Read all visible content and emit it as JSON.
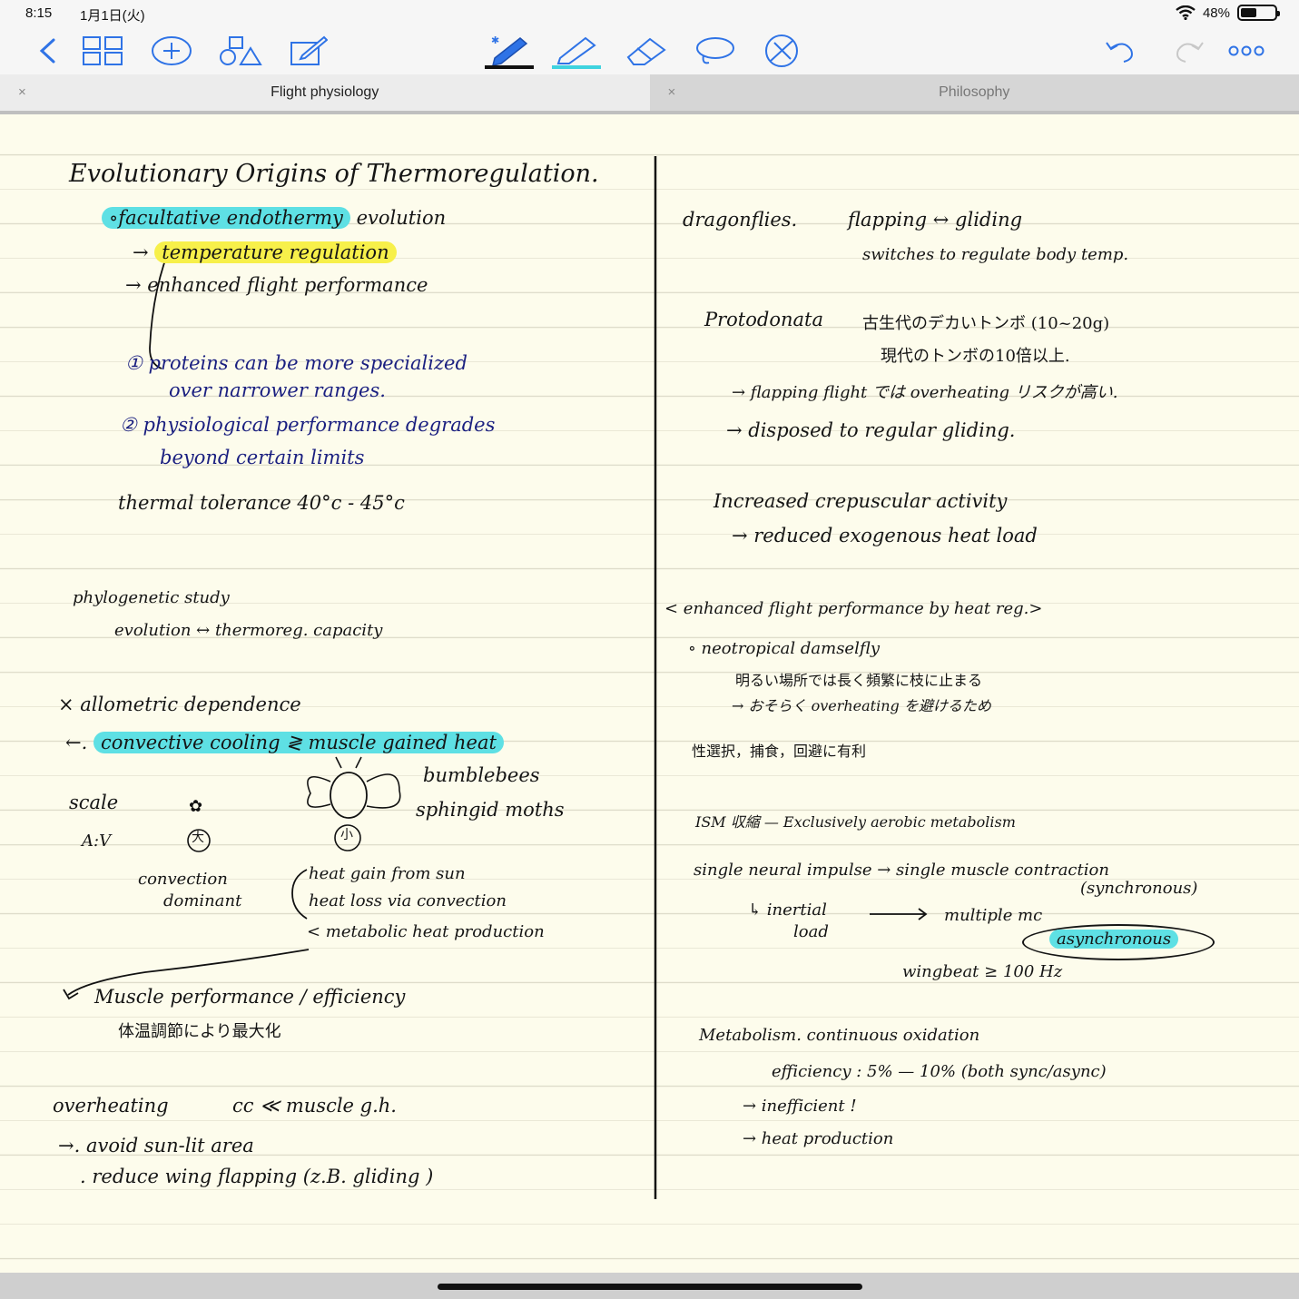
{
  "status": {
    "time": "8:15",
    "date": "1月1日(火)",
    "battery": "48%",
    "battery_level": 0.48
  },
  "toolbar": {
    "left": [
      "back-icon",
      "grid-icon",
      "add-icon",
      "shapes-icon",
      "edit-icon"
    ],
    "center": [
      "pen-icon",
      "highlighter-icon",
      "eraser-icon",
      "lasso-icon",
      "no-write-icon"
    ],
    "right": [
      "undo-icon",
      "redo-icon",
      "more-icon"
    ]
  },
  "tabs": [
    {
      "title": "Flight physiology",
      "close": "×"
    },
    {
      "title": "Philosophy",
      "close": "×"
    }
  ],
  "notes": {
    "left": {
      "title": "Evolutionary Origins of Thermoregulation.",
      "l1": "∘facultative endothermy",
      "l1b": "evolution",
      "l2_arrow": "→",
      "l2": "temperature regulation",
      "l3": "→ enhanced flight performance",
      "b1": "① proteins can be more specialized",
      "b1b": "over narrower ranges.",
      "b2": "② physiological performance degrades",
      "b2b": "beyond certain limits",
      "tol": "thermal tolerance   40°c - 45°c",
      "phy": "phylogenetic study",
      "evo": "evolution ↔ thermoreg. capacity",
      "allo": "× allometric dependence",
      "conv_arrow": "←.",
      "conv": "convective cooling ≷ muscle gained heat",
      "bees": "bumblebees",
      "moths": "sphingid moths",
      "scale": "scale",
      "av": "A:V",
      "av_big": "大",
      "av_small": "小",
      "cd1": "convection",
      "cd2": "dominant",
      "hg": "heat gain from sun",
      "hl": "heat loss via convection",
      "mhp": "< metabolic heat production",
      "mpe": "Muscle performance / efficiency",
      "jp1": "体温調節により最大化",
      "oh": "overheating",
      "oh2": "cc ≪ muscle g.h.",
      "avoid": "→. avoid sun-lit area",
      "reduce": ". reduce wing flapping (z.B. gliding )"
    },
    "right": {
      "dragon": "dragonflies.",
      "flap": "flapping ↔ gliding",
      "switch": "switches to regulate body temp.",
      "proto": "Protodonata",
      "jp_proto": "古生代のデカいトンボ (10~20g)",
      "jp_proto2": "現代のトンボの10倍以上.",
      "flap2": "→ flapping flight では overheating リスクが高い.",
      "disp": "→ disposed to regular gliding.",
      "crep": "Increased crepuscular activity",
      "red": "→ reduced exogenous heat load",
      "enh": "< enhanced flight performance by heat reg.>",
      "damsel": "∘ neotropical damselfly",
      "jp3": "明るい場所では長く頻繁に枝に止まる",
      "jp4": "→ おそらく overheating を避けるため",
      "jp5": "性選択，捕食，回避に有利",
      "ism": "ISM 収縮 — Exclusively aerobic metabolism",
      "single": "single neural impulse → single muscle contraction",
      "sync": "(synchronous)",
      "inert": "↳ inertial",
      "load": "load",
      "arrow_mc": "⟶",
      "multi": "multiple mc",
      "async": "asynchronous",
      "wing": "wingbeat ≥ 100 Hz",
      "meta": "Metabolism. continuous oxidation",
      "eff": "efficiency : 5% — 10%  (both sync/async)",
      "ineff": "→ inefficient !",
      "heat": "→ heat production"
    }
  }
}
